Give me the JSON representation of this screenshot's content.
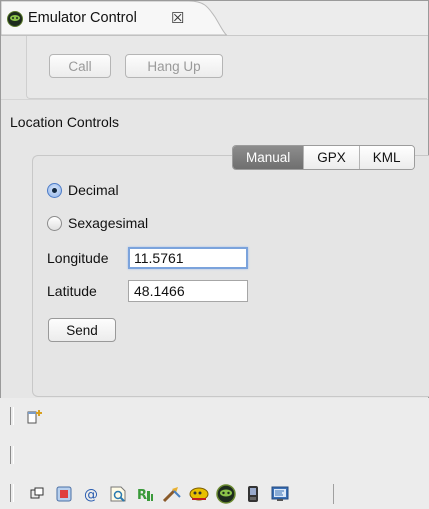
{
  "tab": {
    "title": "Emulator Control",
    "close_glyph": "☒",
    "icon": "android-emulator-icon"
  },
  "telephony": {
    "call_label": "Call",
    "hangup_label": "Hang Up"
  },
  "location": {
    "title": "Location Controls",
    "modes": [
      "Manual",
      "GPX",
      "KML"
    ],
    "selected_mode": "Manual",
    "format_options": [
      "Decimal",
      "Sexagesimal"
    ],
    "selected_format": "Decimal",
    "longitude_label": "Longitude",
    "longitude_value": "11.5761",
    "latitude_label": "Latitude",
    "latitude_value": "48.1466",
    "send_label": "Send"
  },
  "trim_toolbar": {
    "icons": [
      "restore-view-icon",
      "window-layout-icon",
      "devices-icon",
      "at-sign-icon",
      "file-explorer-icon",
      "heap-icon",
      "threads-icon",
      "allocation-icon",
      "emulator-control-icon",
      "device-icon",
      "logcat-icon"
    ]
  },
  "colors": {
    "selected_segment": "#7a7a7a",
    "focus_ring": "#7ba3dc"
  }
}
